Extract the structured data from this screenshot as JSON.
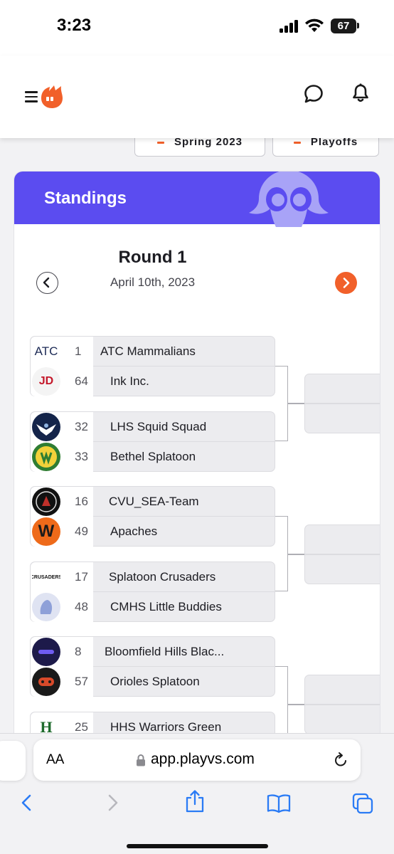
{
  "status_bar": {
    "time": "3:23",
    "battery": "67"
  },
  "app": {
    "icons": [
      "hamburger-menu-icon",
      "playvs-logo-icon",
      "chat-icon",
      "bell-icon"
    ],
    "brand_color": "#f1602a"
  },
  "filters": {
    "season": "Spring 2023",
    "phase": "Playoffs"
  },
  "standings": {
    "title": "Standings",
    "banner_color": "#5b4cf0",
    "round_title": "Round 1",
    "round_date": "April 10th, 2023"
  },
  "bracket": {
    "matches": [
      {
        "teams": [
          {
            "seed": "1",
            "name": "ATC Mammalians",
            "logo_text": "ATC"
          },
          {
            "seed": "64",
            "name": "Ink Inc.",
            "logo_text": "JD"
          }
        ]
      },
      {
        "teams": [
          {
            "seed": "32",
            "name": "LHS Squid Squad",
            "logo_text": ""
          },
          {
            "seed": "33",
            "name": "Bethel Splatoon",
            "logo_text": ""
          }
        ]
      },
      {
        "teams": [
          {
            "seed": "16",
            "name": "CVU_SEA-Team",
            "logo_text": ""
          },
          {
            "seed": "49",
            "name": "Apaches",
            "logo_text": "W"
          }
        ]
      },
      {
        "teams": [
          {
            "seed": "17",
            "name": "Splatoon Crusaders",
            "logo_text": "CRUSADERS"
          },
          {
            "seed": "48",
            "name": "CMHS Little Buddies",
            "logo_text": ""
          }
        ]
      },
      {
        "teams": [
          {
            "seed": "8",
            "name": "Bloomfield Hills Blac...",
            "logo_text": ""
          },
          {
            "seed": "57",
            "name": "Orioles Splatoon",
            "logo_text": ""
          }
        ]
      },
      {
        "teams": [
          {
            "seed": "25",
            "name": "HHS Warriors Green",
            "logo_text": "H"
          }
        ]
      }
    ]
  },
  "browser": {
    "text_size_label": "AA",
    "url": "app.playvs.com",
    "toolbar_icons": [
      "back-icon",
      "forward-icon",
      "share-icon",
      "bookmarks-icon",
      "tabs-icon"
    ]
  }
}
